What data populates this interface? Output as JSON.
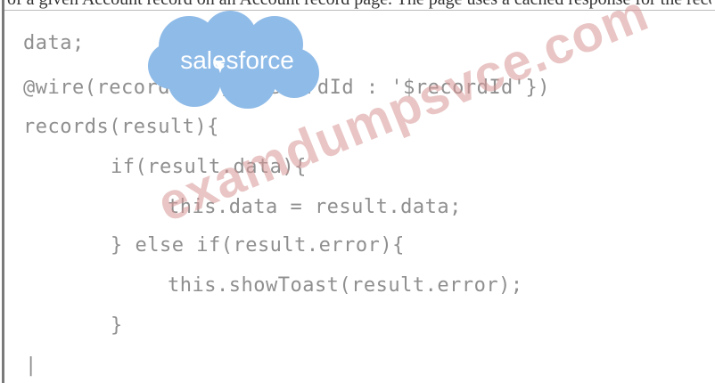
{
  "caption": "of a given Account record on an Account record page. The page uses a cached response for the record",
  "logo": {
    "text": "salesforce",
    "cloud_color": "#8fbbe8"
  },
  "watermark": {
    "text": "examdumpsvce.com",
    "color": "#d79696"
  },
  "code_lines": [
    "data;",
    "@wire(recordList, {recordId : '$recordId'})",
    "records(result){",
    "if(result.data){",
    "this.data = result.data;",
    "} else if(result.error){",
    "this.showToast(result.error);",
    "}",
    "|"
  ]
}
